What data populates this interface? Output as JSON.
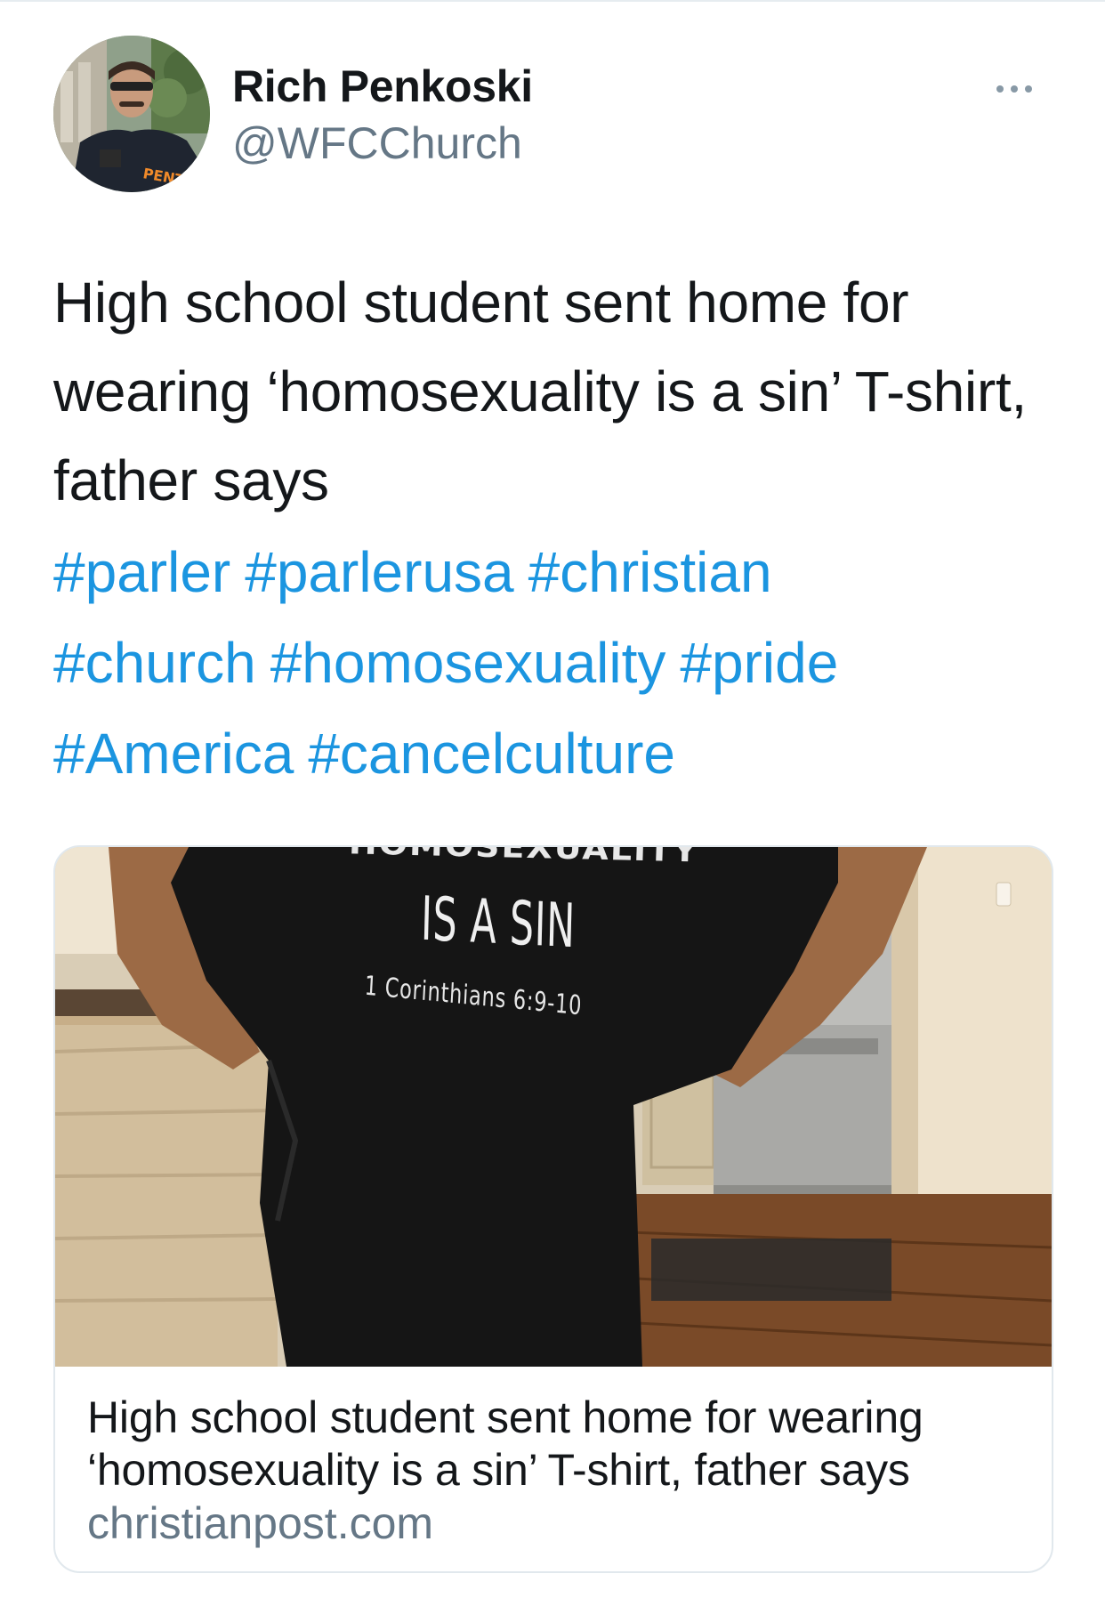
{
  "tweet": {
    "author_name": "Rich Penkoski",
    "author_handle": "@WFCChurch",
    "text": "High school student sent home for wearing ‘homosexuality is a sin’ T-shirt, father says",
    "hashtags": [
      "#parler",
      "#parlerusa",
      "#christian",
      "#church",
      "#homosexuality",
      "#pride",
      "#America",
      "#cancelculture"
    ]
  },
  "avatar": {
    "badge_text": "PENT"
  },
  "card": {
    "image": {
      "shirt_line1": "HOMOSEXUALITY",
      "shirt_line2": "IS A SIN",
      "shirt_line3": "1 Corinthians 6:9-10"
    },
    "title": "High school student sent home for wearing ‘homosexuality is a sin’ T-shirt, father says",
    "domain": "christianpost.com"
  },
  "colors": {
    "link": "#1b95e0",
    "secondary_text": "#657786",
    "primary_text": "#14171a",
    "card_border": "#e1e8ed"
  },
  "icons": {
    "more": "more-horizontal-icon"
  }
}
